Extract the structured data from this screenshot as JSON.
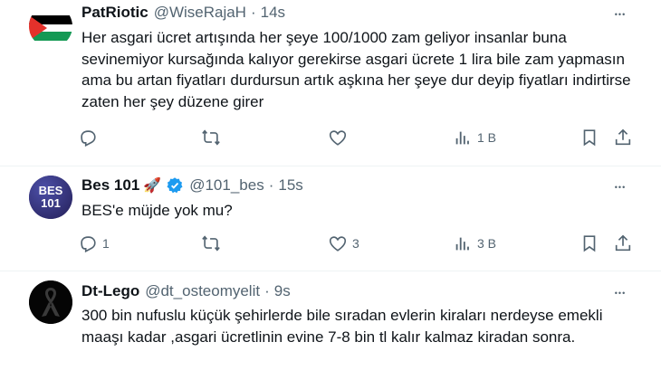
{
  "tweets": [
    {
      "name": "PatRiotic",
      "handle": "@WiseRajaH",
      "time": "14s",
      "text": "Her asgari ücret artışında her şeye 100/1000 zam geliyor insanlar buna sevinemiyor kursağında kalıyor gerekirse asgari ücrete 1 lira bile zam yapmasın ama bu artan fiyatları durdursun artık aşkına her şeye dur deyip fiyatları indirtirse zaten her şey düzene girer",
      "replies": "",
      "retweets": "",
      "likes": "",
      "views": "1 B",
      "avatar_icon": "palestine-flag-icon"
    },
    {
      "name": "Bes 101",
      "name_emoji": "🚀",
      "verified": true,
      "handle": "@101_bes",
      "time": "15s",
      "text": "BES'e müjde yok mu?",
      "replies": "1",
      "retweets": "",
      "likes": "3",
      "views": "3 B",
      "avatar_text_top": "BES",
      "avatar_text_bottom": "101"
    },
    {
      "name": "Dt-Lego",
      "handle": "@dt_osteomyelit",
      "time": "9s",
      "text": "300 bin nufuslu küçük şehirlerde bile sıradan evlerin kiraları nerdeyse emekli maaşı kadar ,asgari ücretlinin evine 7-8 bin tl kalır kalmaz kiradan sonra.",
      "avatar_icon": "black-ribbon-icon"
    }
  ],
  "separator": "·",
  "more_glyph": "•••",
  "colors": {
    "text": "#0f1419",
    "muted": "#536471",
    "verified": "#1d9bf0",
    "border": "#eff3f4"
  }
}
